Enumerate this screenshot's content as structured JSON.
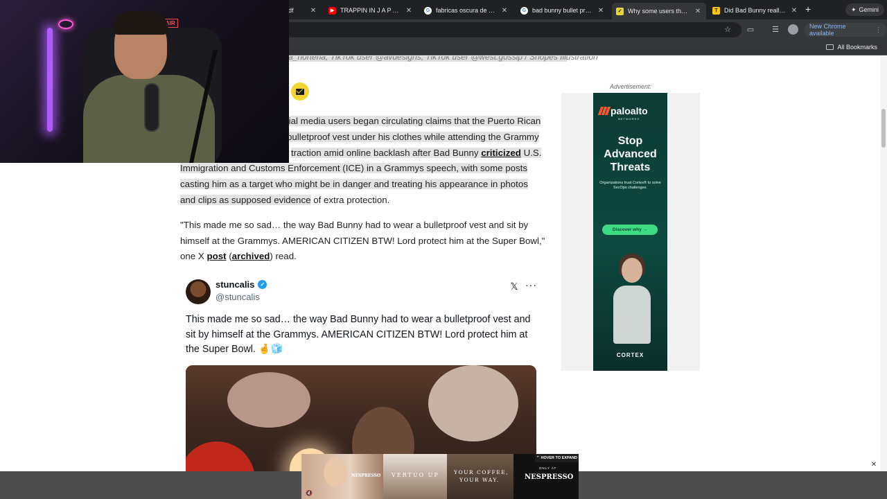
{
  "browser": {
    "tabs": [
      {
        "title": "df",
        "favicon": "doc-icon",
        "active": false
      },
      {
        "title": "TRAPPIN IN J A P A N",
        "favicon": "youtube-icon",
        "active": false
      },
      {
        "title": "fabricas oscura de la ch",
        "favicon": "google-icon",
        "active": false
      },
      {
        "title": "bad bunny bullet proof v",
        "favicon": "google-icon",
        "active": false
      },
      {
        "title": "Why some users though",
        "favicon": "snopes-icon",
        "active": true
      },
      {
        "title": "Did Bad Bunny really we",
        "favicon": "truth-icon",
        "active": false
      }
    ],
    "new_tab_label": "+",
    "gemini_label": "Gemini",
    "new_chrome_label": "New Chrome available",
    "all_bookmarks_label": "All Bookmarks"
  },
  "page": {
    "image_credit": "a_norteña; TikTok user @avdesigns; TikTok user @west.gossip / Snopes Illustration",
    "article": {
      "p1_line1": "cial media users began circulating claims that the Puerto Rican",
      "p1_line2": "bulletproof vest under his clothes while attending the Grammy",
      "p1_line3a": "traction amid online backlash after Bad Bunny ",
      "p1_link": "criticized",
      "p1_line3b": " U.S.",
      "p1_line4": "Immigration and Customs Enforcement (ICE) in a Grammys speech, with some posts",
      "p1_line5": "casting him as a target who might be in danger and treating his appearance in photos",
      "p1_line6a": "and clips as supposed evidence",
      "p1_line6b": " of extra protection.",
      "p2_text": "\"This made me so sad… the way Bad Bunny had to wear a bulletproof vest and sit by himself at the Grammys. AMERICAN CITIZEN BTW! Lord protect him at the Super Bowl,\" one X ",
      "p2_link1": "post",
      "p2_mid": " (",
      "p2_link2": "archived",
      "p2_end": ") read."
    },
    "tweet": {
      "name": "stuncalis",
      "handle": "@stuncalis",
      "text": "This made me so sad… the way Bad Bunny had to wear a bulletproof vest and sit by himself at the Grammys. AMERICAN CITIZEN BTW! Lord protect him at the Super Bowl. 🤞🧊"
    },
    "ad_sidebar": {
      "label": "Advertisement:",
      "brand": "paloalto",
      "brand_sub": "NETWORKS",
      "headline": "Stop Advanced Threats",
      "body": "Organizations trust Cortex® to solve SecOps challenges.",
      "cta": "Discover why →",
      "footer": "CORTEX"
    },
    "bottom_ad": {
      "brand": "NESPRESSO",
      "panel2": "VERTUO UP",
      "panel3_line1": "YOUR COFFEE,",
      "panel3_line2": "YOUR WAY.",
      "panel4_top": "ONLY AT",
      "hover_label": "HOVER TO EXPAND"
    }
  },
  "webcam": {
    "sign": "ON AIR"
  },
  "colors": {
    "tab_bar": "#202124",
    "toolbar": "#35363a",
    "highlight": "#e3e3e3",
    "email_button": "#f5d533",
    "ad_green": "#0e4a40",
    "ad_cta": "#3ddc84",
    "verified": "#1d9bf0"
  }
}
